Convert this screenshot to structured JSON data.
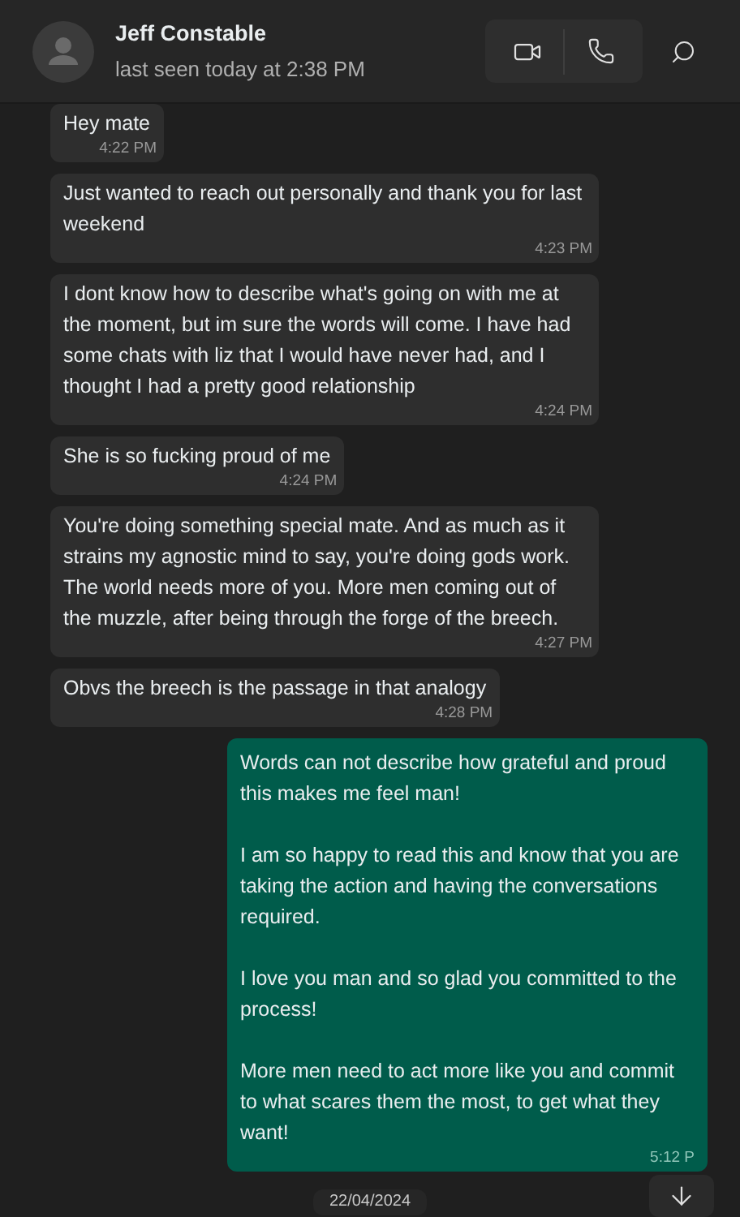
{
  "contact": {
    "name": "Jeff Constable",
    "status": "last seen today at 2:38 PM"
  },
  "messages": [
    {
      "kind": "incoming",
      "paragraphs": [
        "Hey mate"
      ],
      "time": "4:22 PM"
    },
    {
      "kind": "incoming",
      "paragraphs": [
        "Just wanted to reach out personally and thank you for last weekend"
      ],
      "time": "4:23 PM"
    },
    {
      "kind": "incoming",
      "paragraphs": [
        "I dont know how to describe what's going on with me at the moment, but im sure the words will come. I have had some chats with liz that I would have never had, and I thought I had a pretty good relationship"
      ],
      "time": "4:24 PM"
    },
    {
      "kind": "incoming",
      "paragraphs": [
        "She is so fucking proud of me"
      ],
      "time": "4:24 PM"
    },
    {
      "kind": "incoming",
      "paragraphs": [
        "You're doing something special mate. And as much as it strains my agnostic mind to say, you're doing gods work. The world needs more of you. More men coming out of the muzzle, after being through the forge of the breech."
      ],
      "time": "4:27 PM"
    },
    {
      "kind": "incoming",
      "paragraphs": [
        "Obvs the breech is the passage in that analogy"
      ],
      "time": "4:28 PM"
    },
    {
      "kind": "outgoing",
      "paragraphs": [
        "Words can not describe how grateful and proud this makes me feel man!",
        "I am so happy to read this and know that you are taking the action and having the conversations required.",
        "I love you man and so glad you committed to the process!",
        "More men need to act more like you and commit to what scares them the most, to get what they want!"
      ],
      "time": "5:12 P"
    }
  ],
  "date_chip": "22/04/2024"
}
